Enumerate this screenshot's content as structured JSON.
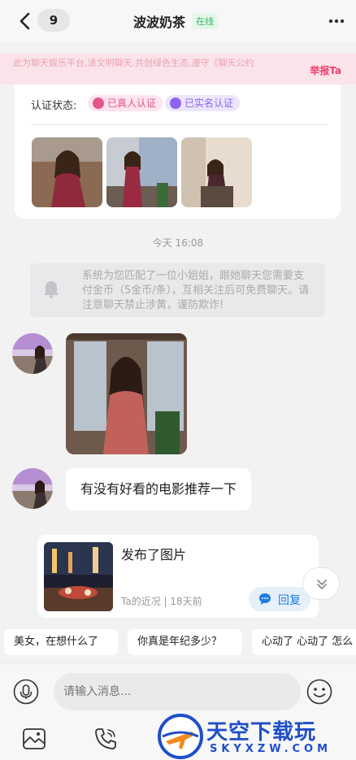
{
  "header": {
    "back_count": "9",
    "title": "波波奶茶",
    "status": "在线"
  },
  "notice": {
    "text": "此为聊天娱乐平台,请文明聊天,共创绿色生态,遵守《聊天公约",
    "report_label": "举报Ta"
  },
  "profile_card": {
    "cert_label": "认证状态:",
    "tags": [
      "已真人认证",
      "已实名认证"
    ]
  },
  "timestamp": "今天 16:08",
  "system_message": "系统为您匹配了一位小姐姐，跟她聊天您需要支付金币（5金币/条），互相关注后可免费聊天。请注意聊天禁止涉黄，谨防欺诈!",
  "messages": {
    "text_message": "有没有好看的电影推荐一下"
  },
  "post": {
    "title": "发布了图片",
    "meta": "Ta的近况 | 18天前",
    "reply_label": "回复"
  },
  "quick_replies": [
    "美女，在想什么了",
    "你真是年纪多少？",
    "心动了 心动了 怎么"
  ],
  "input": {
    "placeholder": "请输入消息..."
  },
  "watermark": {
    "cn": "天空下载玩",
    "en": "SKYXZW.COM"
  },
  "colors": {
    "accent_pink": "#ee3f6a",
    "online_green": "#2fb75f",
    "reply_blue": "#1f7ce5"
  }
}
